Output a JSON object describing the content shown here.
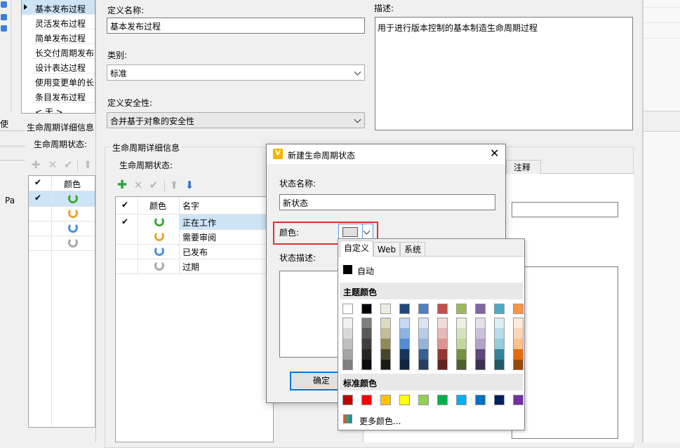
{
  "left_list": {
    "items": [
      {
        "label": "基本发布过程",
        "selected": true
      },
      {
        "label": "灵活发布过程"
      },
      {
        "label": "简单发布过程"
      },
      {
        "label": "长交付周期发布过程"
      },
      {
        "label": "设计表达过程"
      },
      {
        "label": "使用变更单的长交付"
      },
      {
        "label": "条目发布过程"
      },
      {
        "label": "< 无 >"
      }
    ]
  },
  "form": {
    "def_name_label": "定义名称:",
    "def_name_value": "基本发布过程",
    "category_label": "类别:",
    "category_value": "标准",
    "security_label": "定义安全性:",
    "security_value": "合并基于对象的安全性",
    "desc_label": "描述:",
    "desc_value": "用于进行版本控制的基本制造生命周期过程"
  },
  "bg_left": {
    "tab_fragment": "使用",
    "details_title": "生命周期详细信息",
    "states_label": "生命周期状态:",
    "col_color": "颜色",
    "pa_fragment": "Pa"
  },
  "lifecycle": {
    "group_title": "生命周期详细信息",
    "states_label": "生命周期状态:",
    "col_color": "颜色",
    "col_name": "名字",
    "states": [
      {
        "name": "正在工作",
        "color": "#3aaa35",
        "selected": true
      },
      {
        "name": "需要审阅",
        "color": "#e6a532"
      },
      {
        "name": "已发布",
        "color": "#4a90d9"
      },
      {
        "name": "过期",
        "color": "#a8a8a8"
      }
    ],
    "notes_tab": "注释"
  },
  "dialog": {
    "title": "新建生命周期状态",
    "state_name_label": "状态名称:",
    "state_name_value": "新状态",
    "color_label": "颜色:",
    "state_desc_label": "状态描述:",
    "ok_button": "确定"
  },
  "color_picker": {
    "tabs": [
      "自定义",
      "Web",
      "系统"
    ],
    "auto_label": "自动",
    "theme_title": "主题颜色",
    "theme_top": [
      "#ffffff",
      "#000000",
      "#eeece1",
      "#1f497d",
      "#4f81bd",
      "#c0504d",
      "#9bbb59",
      "#8064a2",
      "#4bacc6",
      "#f79646"
    ],
    "theme_shades": [
      [
        "#f2f2f2",
        "#d8d8d8",
        "#bfbfbf",
        "#a5a5a5",
        "#7f7f7f"
      ],
      [
        "#7f7f7f",
        "#595959",
        "#3f3f3f",
        "#262626",
        "#0c0c0c"
      ],
      [
        "#ddd9c3",
        "#c4bd97",
        "#938953",
        "#494429",
        "#1d1b10"
      ],
      [
        "#c6d9f0",
        "#8db3e2",
        "#548dd4",
        "#17365d",
        "#0f243e"
      ],
      [
        "#dbe5f1",
        "#b8cce4",
        "#95b3d7",
        "#366092",
        "#244061"
      ],
      [
        "#f2dcdb",
        "#e5b9b7",
        "#d99694",
        "#953734",
        "#632423"
      ],
      [
        "#ebf1dd",
        "#d7e3bc",
        "#c3d69b",
        "#76923c",
        "#4f6128"
      ],
      [
        "#e5e0ec",
        "#ccc1d9",
        "#b2a2c7",
        "#5f497a",
        "#3f3151"
      ],
      [
        "#dbeef3",
        "#b7dde8",
        "#92cddc",
        "#31859b",
        "#205867"
      ],
      [
        "#fdeada",
        "#fbd5b5",
        "#fac08f",
        "#e36c09",
        "#974806"
      ]
    ],
    "standard_title": "标准颜色",
    "standard": [
      "#c00000",
      "#ff0000",
      "#ffc000",
      "#ffff00",
      "#92d050",
      "#00b050",
      "#00b0f0",
      "#0070c0",
      "#002060",
      "#7030a0"
    ],
    "more_colors": "更多颜色..."
  },
  "colors": {
    "accent_red": "#e03030",
    "selection": "#cde4f7",
    "dialog_border": "#7a7a7a"
  }
}
